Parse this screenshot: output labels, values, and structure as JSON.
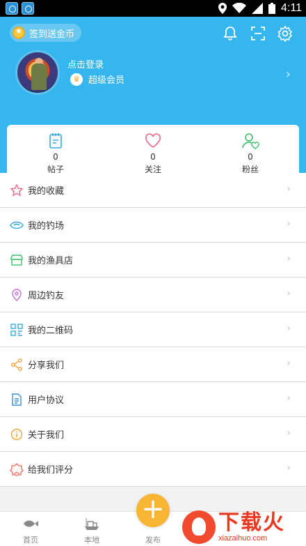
{
  "status_bar": {
    "time": "4:11",
    "icons": [
      "location-icon",
      "wifi-icon",
      "signal-icon",
      "battery-icon"
    ]
  },
  "header": {
    "signin_label": "签到送金币",
    "login_prompt": "点击登录",
    "vip_label": "超级会员",
    "icons": [
      "bell-icon",
      "scan-icon",
      "gear-icon"
    ],
    "bg_color": "#36b6ee"
  },
  "stats": [
    {
      "name": "posts",
      "count": "0",
      "label": "帖子",
      "icon": "notepad-icon"
    },
    {
      "name": "following",
      "count": "0",
      "label": "关注",
      "icon": "heart-icon"
    },
    {
      "name": "fans",
      "count": "0",
      "label": "粉丝",
      "icon": "user-heart-icon"
    }
  ],
  "menu": [
    {
      "label": "我的收藏",
      "icon": "star-icon",
      "color": "#f06a8a"
    },
    {
      "label": "我的钓场",
      "icon": "fishing-spot-icon",
      "color": "#36a9e1"
    },
    {
      "label": "我的渔具店",
      "icon": "store-icon",
      "color": "#3ec06b"
    },
    {
      "label": "周边钓友",
      "icon": "location-pin-icon",
      "color": "#c46fd6"
    },
    {
      "label": "我的二维码",
      "icon": "qrcode-icon",
      "color": "#36a9e1"
    },
    {
      "label": "分享我们",
      "icon": "share-icon",
      "color": "#f7a33a"
    },
    {
      "label": "用户协议",
      "icon": "document-icon",
      "color": "#3b8fe0"
    },
    {
      "label": "关于我们",
      "icon": "info-icon",
      "color": "#f7a33a"
    },
    {
      "label": "给我们评分",
      "icon": "badge-icon",
      "color": "#f06a5a"
    }
  ],
  "bottom_nav": {
    "home": "首页",
    "local": "本地",
    "publish": "发布"
  },
  "watermark": {
    "big": "下载火",
    "small": "xiazaihuo.com"
  }
}
